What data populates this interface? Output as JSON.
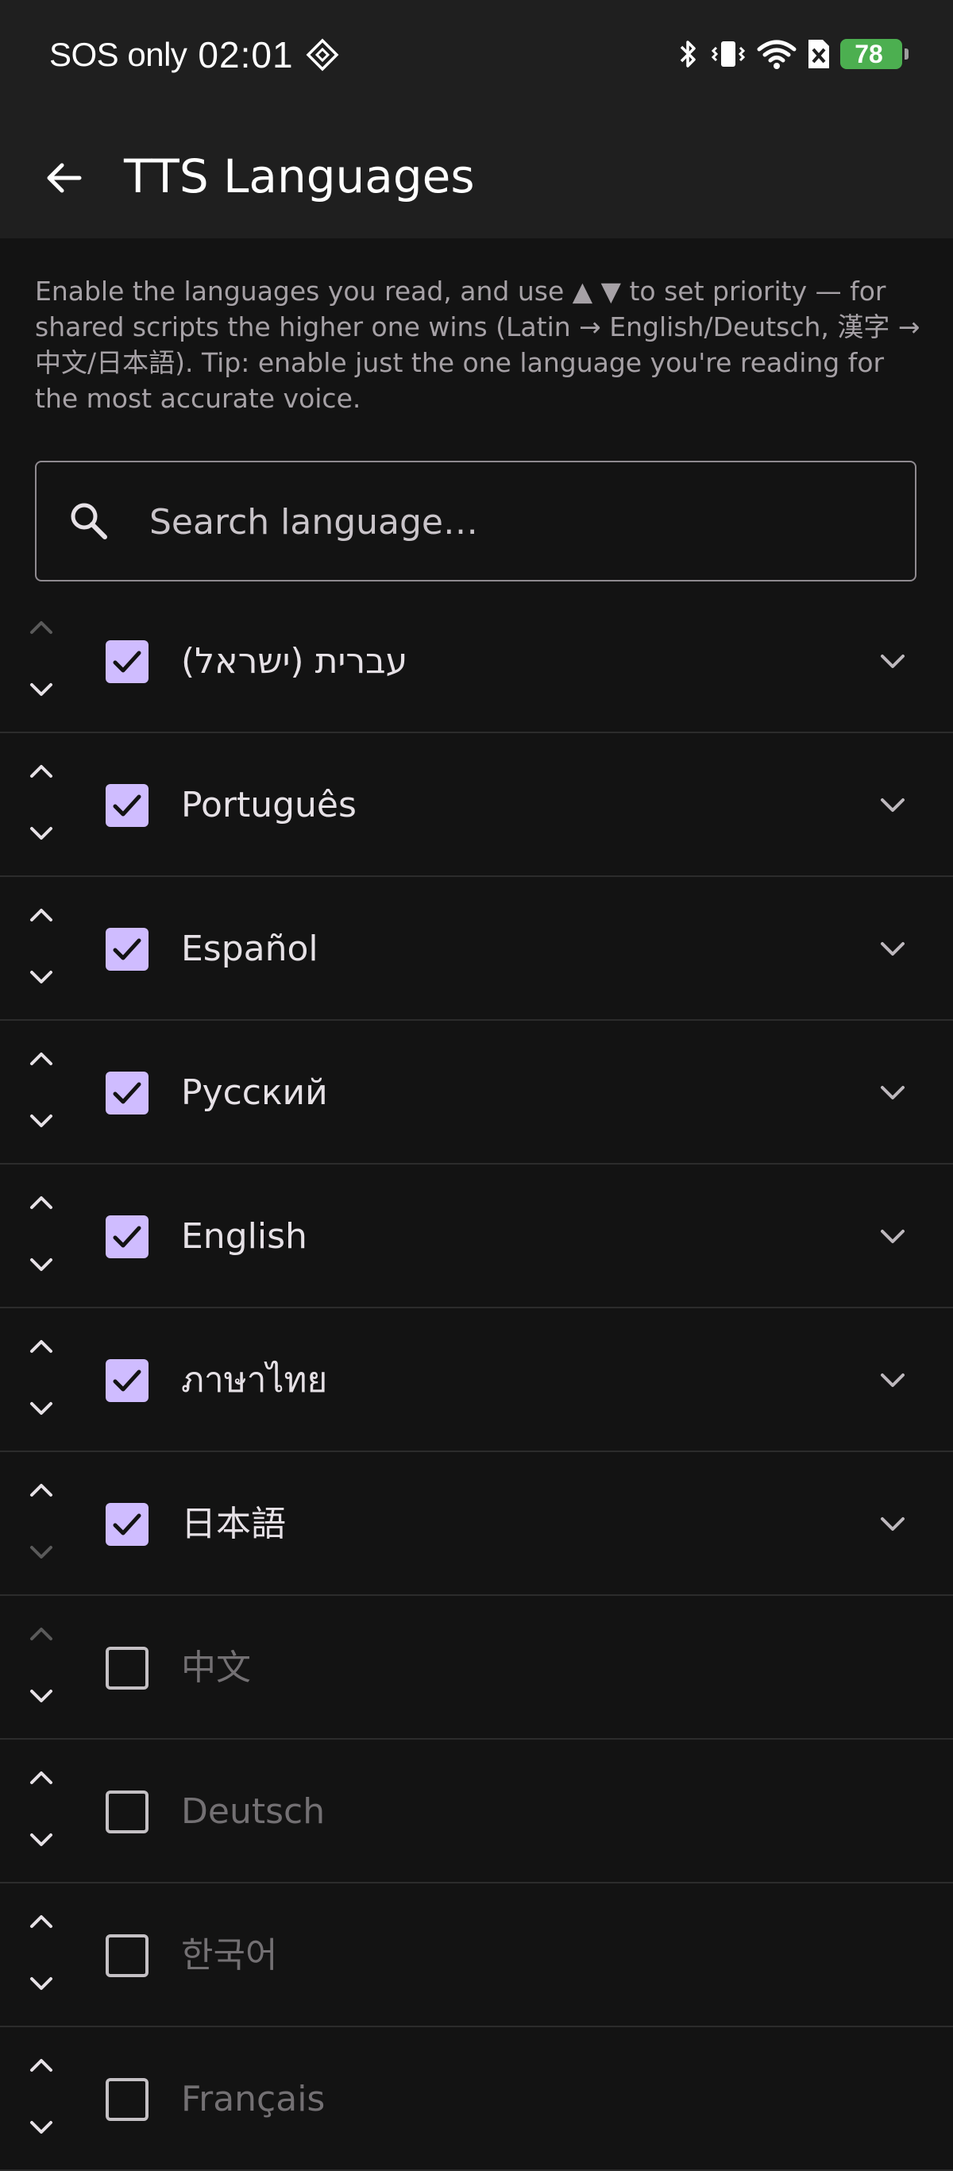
{
  "status_bar": {
    "carrier": "SOS only",
    "time": "02:01",
    "battery": "78"
  },
  "header": {
    "title": "TTS Languages"
  },
  "description": "Enable the languages you read, and use ▲ ▼ to set priority — for shared scripts the higher one wins (Latin → English/Deutsch, 漢字 → 中文/日本語). Tip: enable just the one language you're reading for the most accurate voice.",
  "search": {
    "placeholder": "Search language…",
    "value": ""
  },
  "languages": [
    {
      "label": "עברית (ישראל)",
      "enabled": true,
      "can_move_up": false,
      "can_move_down": true,
      "expandable": true
    },
    {
      "label": "Português",
      "enabled": true,
      "can_move_up": true,
      "can_move_down": true,
      "expandable": true
    },
    {
      "label": "Español",
      "enabled": true,
      "can_move_up": true,
      "can_move_down": true,
      "expandable": true
    },
    {
      "label": "Русский",
      "enabled": true,
      "can_move_up": true,
      "can_move_down": true,
      "expandable": true
    },
    {
      "label": "English",
      "enabled": true,
      "can_move_up": true,
      "can_move_down": true,
      "expandable": true
    },
    {
      "label": "ภาษาไทย",
      "enabled": true,
      "can_move_up": true,
      "can_move_down": true,
      "expandable": true
    },
    {
      "label": "日本語",
      "enabled": true,
      "can_move_up": true,
      "can_move_down": false,
      "expandable": true
    },
    {
      "label": "中文",
      "enabled": false,
      "can_move_up": false,
      "can_move_down": true,
      "expandable": false
    },
    {
      "label": "Deutsch",
      "enabled": false,
      "can_move_up": true,
      "can_move_down": true,
      "expandable": false
    },
    {
      "label": "한국어",
      "enabled": false,
      "can_move_up": true,
      "can_move_down": true,
      "expandable": false
    },
    {
      "label": "Français",
      "enabled": false,
      "can_move_up": true,
      "can_move_down": true,
      "expandable": false
    }
  ],
  "colors": {
    "accent": "#cfbcff",
    "background": "#131313",
    "bar": "#1f1f1f",
    "battery": "#4caf50"
  },
  "icons": {
    "back": "arrow-left-icon",
    "search": "magnifier-icon",
    "up": "chevron-up-icon",
    "down": "chevron-down-icon",
    "expand": "expand-more-icon",
    "check": "check-icon"
  }
}
